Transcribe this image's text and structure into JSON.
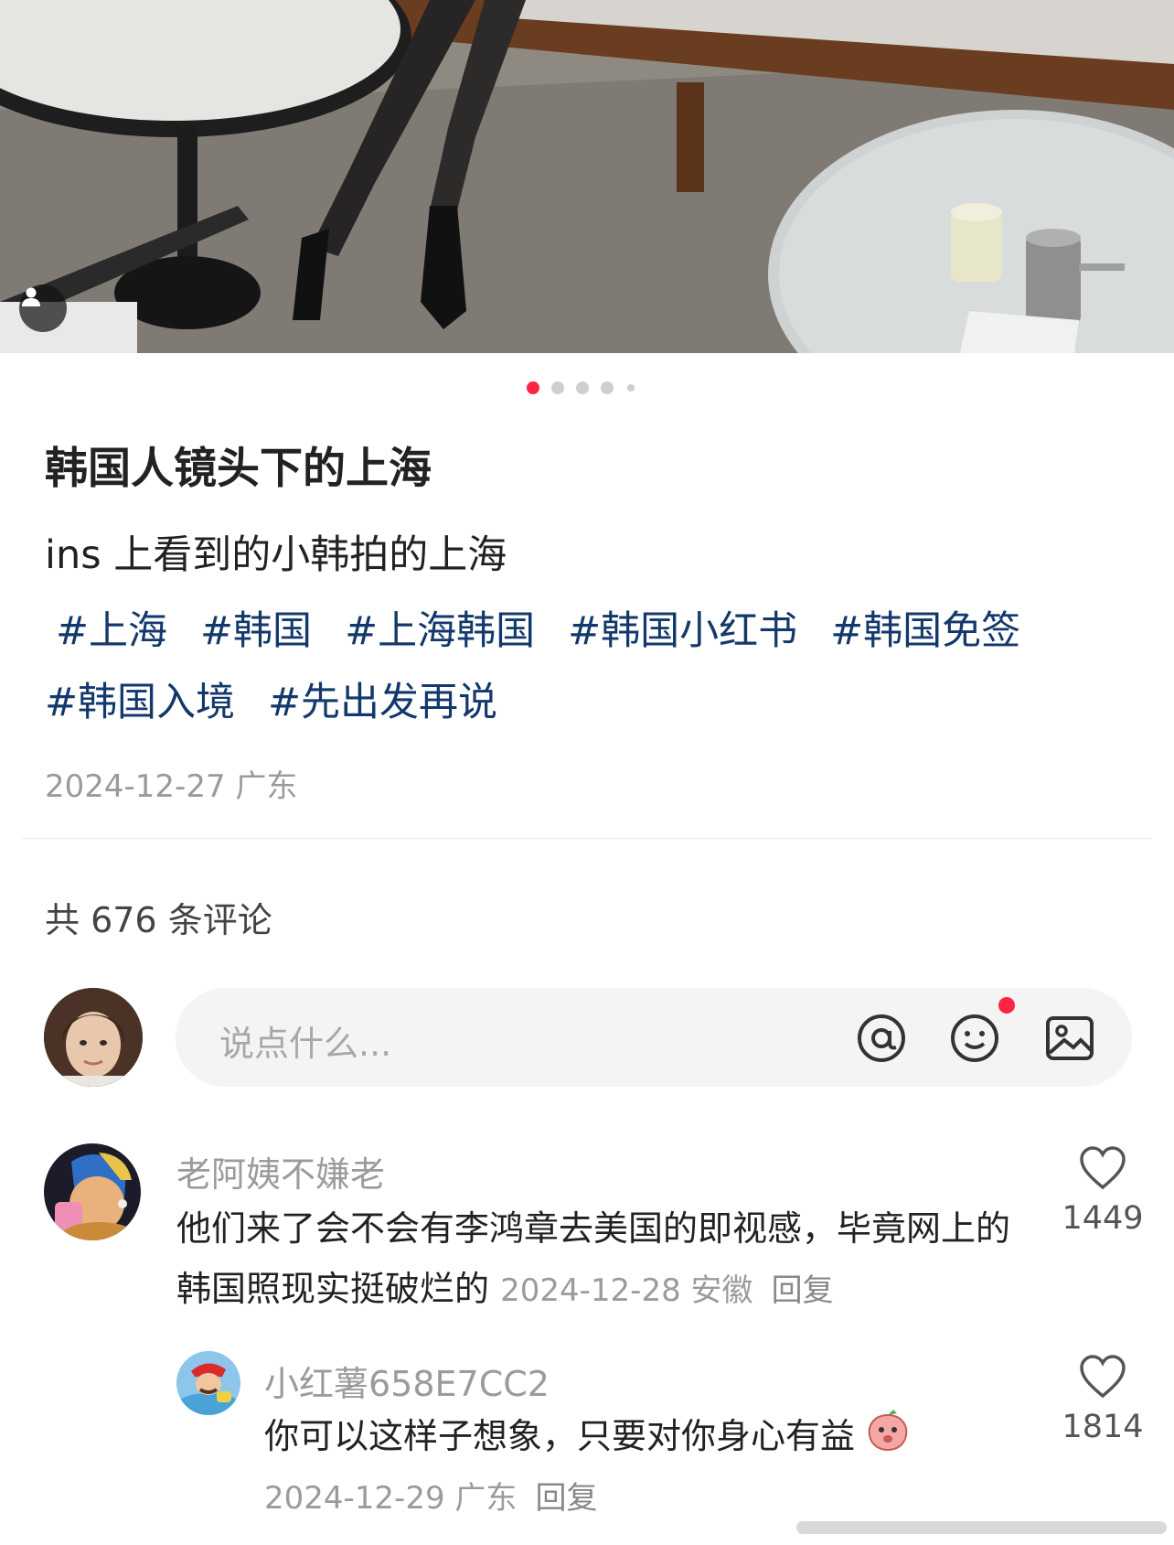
{
  "post": {
    "title": "韩国人镜头下的上海",
    "description": "ins 上看到的小韩拍的上海",
    "tags": [
      "#上海",
      "#韩国",
      "#上海韩国",
      "#韩国小红书",
      "#韩国免签",
      "#韩国入境",
      "#先出发再说"
    ],
    "meta": "2024-12-27 广东",
    "image_count": 5,
    "current_image": 1
  },
  "comments_header": "共 676 条评论",
  "input": {
    "placeholder": "说点什么...",
    "icons": [
      "at-icon",
      "emoji-icon",
      "image-icon"
    ]
  },
  "comments": [
    {
      "user": "老阿姨不嫌老",
      "text": "他们来了会不会有李鸿章去美国的即视感，毕竟网上的韩国照现实挺破烂的",
      "time": "2024-12-28 安徽",
      "reply": "回复",
      "likes": "1449"
    },
    {
      "user": "小红薯658E7CC2",
      "text": "你可以这样子想象，只要对你身心有益",
      "time": "2024-12-29 广东",
      "reply": "回复",
      "likes": "1814"
    }
  ],
  "colors": {
    "accent": "#ff2442",
    "tag": "#13386c",
    "muted": "#9b9b9b"
  }
}
